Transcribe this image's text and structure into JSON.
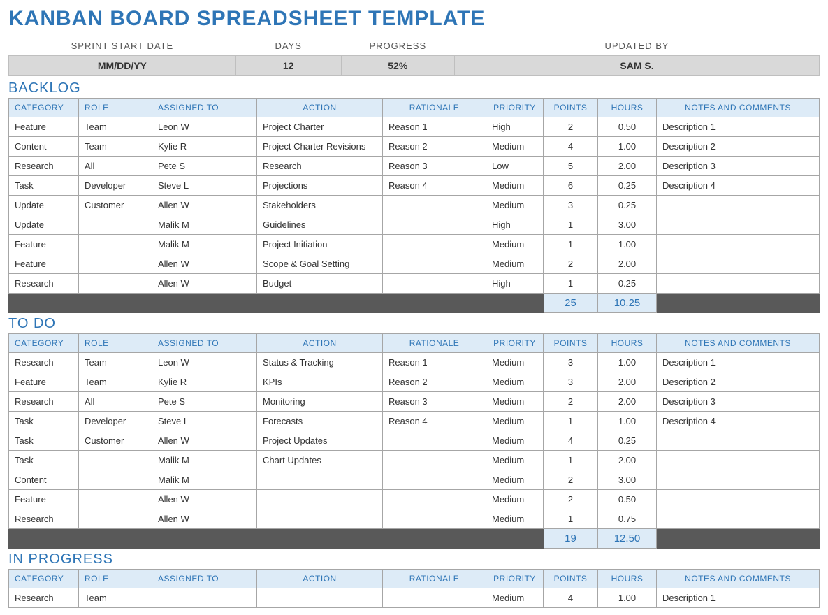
{
  "title": "KANBAN BOARD SPREADSHEET TEMPLATE",
  "meta": {
    "headers": {
      "start": "SPRINT START DATE",
      "days": "DAYS",
      "progress": "PROGRESS",
      "updated": "UPDATED BY"
    },
    "values": {
      "start": "MM/DD/YY",
      "days": "12",
      "progress": "52%",
      "updated": "SAM S."
    }
  },
  "columns": {
    "category": "CATEGORY",
    "role": "ROLE",
    "assigned": "ASSIGNED TO",
    "action": "ACTION",
    "rationale": "RATIONALE",
    "priority": "PRIORITY",
    "points": "POINTS",
    "hours": "HOURS",
    "notes": "NOTES AND COMMENTS"
  },
  "sections": [
    {
      "title": "BACKLOG",
      "rows": [
        {
          "category": "Feature",
          "role": "Team",
          "assigned": "Leon W",
          "action": "Project Charter",
          "rationale": "Reason 1",
          "priority": "High",
          "points": "2",
          "hours": "0.50",
          "notes": "Description 1"
        },
        {
          "category": "Content",
          "role": "Team",
          "assigned": "Kylie R",
          "action": "Project Charter Revisions",
          "rationale": "Reason 2",
          "priority": "Medium",
          "points": "4",
          "hours": "1.00",
          "notes": "Description 2"
        },
        {
          "category": "Research",
          "role": "All",
          "assigned": "Pete S",
          "action": "Research",
          "rationale": "Reason 3",
          "priority": "Low",
          "points": "5",
          "hours": "2.00",
          "notes": "Description 3"
        },
        {
          "category": "Task",
          "role": "Developer",
          "assigned": "Steve L",
          "action": "Projections",
          "rationale": "Reason 4",
          "priority": "Medium",
          "points": "6",
          "hours": "0.25",
          "notes": "Description 4"
        },
        {
          "category": "Update",
          "role": "Customer",
          "assigned": "Allen W",
          "action": "Stakeholders",
          "rationale": "",
          "priority": "Medium",
          "points": "3",
          "hours": "0.25",
          "notes": ""
        },
        {
          "category": "Update",
          "role": "",
          "assigned": "Malik M",
          "action": "Guidelines",
          "rationale": "",
          "priority": "High",
          "points": "1",
          "hours": "3.00",
          "notes": ""
        },
        {
          "category": "Feature",
          "role": "",
          "assigned": "Malik M",
          "action": "Project Initiation",
          "rationale": "",
          "priority": "Medium",
          "points": "1",
          "hours": "1.00",
          "notes": ""
        },
        {
          "category": "Feature",
          "role": "",
          "assigned": "Allen W",
          "action": "Scope & Goal Setting",
          "rationale": "",
          "priority": "Medium",
          "points": "2",
          "hours": "2.00",
          "notes": ""
        },
        {
          "category": "Research",
          "role": "",
          "assigned": "Allen W",
          "action": "Budget",
          "rationale": "",
          "priority": "High",
          "points": "1",
          "hours": "0.25",
          "notes": ""
        }
      ],
      "totals": {
        "points": "25",
        "hours": "10.25"
      }
    },
    {
      "title": "TO DO",
      "rows": [
        {
          "category": "Research",
          "role": "Team",
          "assigned": "Leon W",
          "action": "Status & Tracking",
          "rationale": "Reason 1",
          "priority": "Medium",
          "points": "3",
          "hours": "1.00",
          "notes": "Description 1"
        },
        {
          "category": "Feature",
          "role": "Team",
          "assigned": "Kylie R",
          "action": "KPIs",
          "rationale": "Reason 2",
          "priority": "Medium",
          "points": "3",
          "hours": "2.00",
          "notes": "Description 2"
        },
        {
          "category": "Research",
          "role": "All",
          "assigned": "Pete S",
          "action": "Monitoring",
          "rationale": "Reason 3",
          "priority": "Medium",
          "points": "2",
          "hours": "2.00",
          "notes": "Description 3"
        },
        {
          "category": "Task",
          "role": "Developer",
          "assigned": "Steve L",
          "action": "Forecasts",
          "rationale": "Reason 4",
          "priority": "Medium",
          "points": "1",
          "hours": "1.00",
          "notes": "Description 4"
        },
        {
          "category": "Task",
          "role": "Customer",
          "assigned": "Allen W",
          "action": "Project Updates",
          "rationale": "",
          "priority": "Medium",
          "points": "4",
          "hours": "0.25",
          "notes": ""
        },
        {
          "category": "Task",
          "role": "",
          "assigned": "Malik M",
          "action": "Chart Updates",
          "rationale": "",
          "priority": "Medium",
          "points": "1",
          "hours": "2.00",
          "notes": ""
        },
        {
          "category": "Content",
          "role": "",
          "assigned": "Malik M",
          "action": "",
          "rationale": "",
          "priority": "Medium",
          "points": "2",
          "hours": "3.00",
          "notes": ""
        },
        {
          "category": "Feature",
          "role": "",
          "assigned": "Allen W",
          "action": "",
          "rationale": "",
          "priority": "Medium",
          "points": "2",
          "hours": "0.50",
          "notes": ""
        },
        {
          "category": "Research",
          "role": "",
          "assigned": "Allen W",
          "action": "",
          "rationale": "",
          "priority": "Medium",
          "points": "1",
          "hours": "0.75",
          "notes": ""
        }
      ],
      "totals": {
        "points": "19",
        "hours": "12.50"
      }
    },
    {
      "title": "IN PROGRESS",
      "rows": [
        {
          "category": "Research",
          "role": "Team",
          "assigned": "",
          "action": "",
          "rationale": "",
          "priority": "Medium",
          "points": "4",
          "hours": "1.00",
          "notes": "Description 1"
        }
      ],
      "totals": null
    }
  ]
}
